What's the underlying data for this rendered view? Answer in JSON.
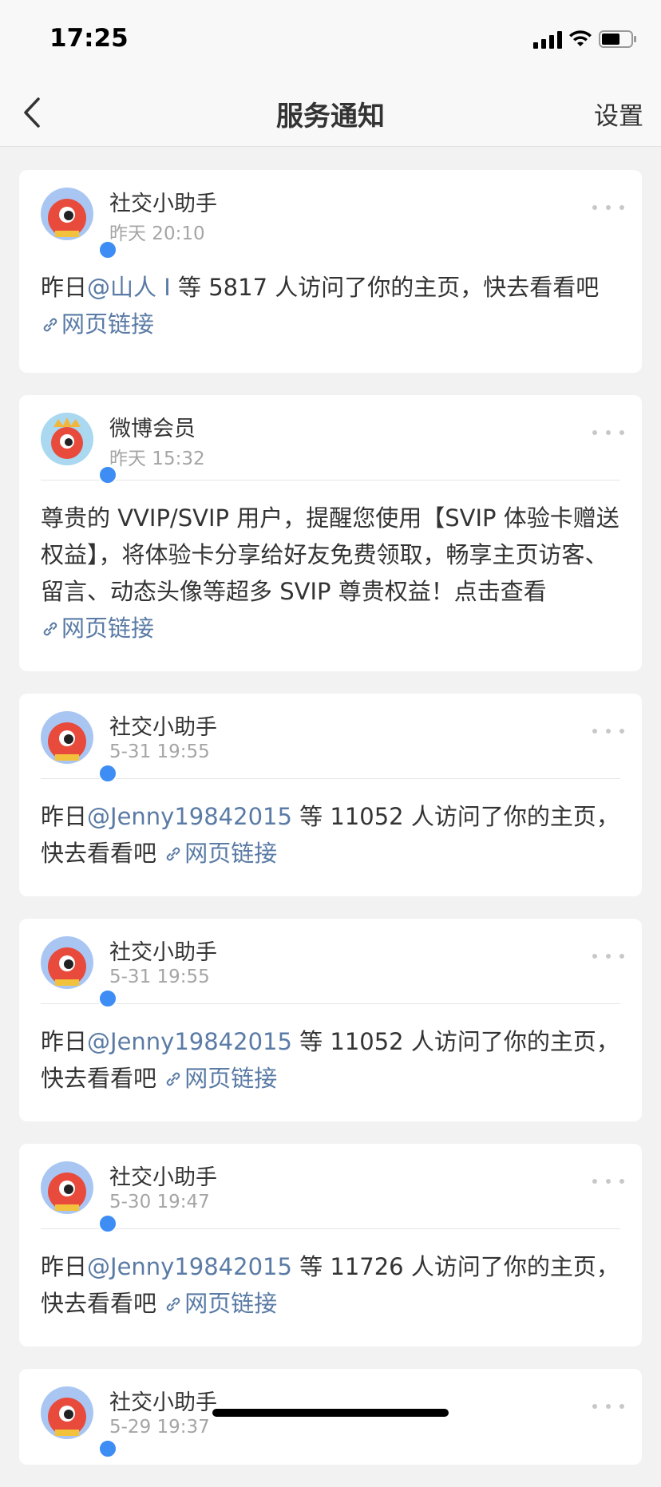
{
  "status_bar": {
    "time": "17:25"
  },
  "nav": {
    "title": "服务通知",
    "settings": "设置"
  },
  "messages": [
    {
      "sender": "社交小助手",
      "time": "昨天 20:10",
      "prefix": "昨日",
      "mention": "@山人 I",
      "text": " 等 5817 人访问了你的主页，快去看看吧",
      "link": "网页链接",
      "avatar": "social-assistant-avatar"
    },
    {
      "sender": "微博会员",
      "time": "昨天 15:32",
      "prefix": "",
      "mention": "",
      "text": "尊贵的 VVIP/SVIP 用户，提醒您使用【SVIP 体验卡赠送权益】，将体验卡分享给好友免费领取，畅享主页访客、留言、动态头像等超多 SVIP 尊贵权益！点击查看",
      "link": "网页链接",
      "avatar": "weibo-vip-avatar"
    },
    {
      "sender": "社交小助手",
      "time": "5-31 19:55",
      "prefix": "昨日",
      "mention": "@Jenny19842015",
      "text": " 等 11052 人访问了你的主页，快去看看吧",
      "link": "网页链接",
      "avatar": "social-assistant-avatar"
    },
    {
      "sender": "社交小助手",
      "time": "5-31 19:55",
      "prefix": "昨日",
      "mention": "@Jenny19842015",
      "text": " 等 11052 人访问了你的主页，快去看看吧",
      "link": "网页链接",
      "avatar": "social-assistant-avatar"
    },
    {
      "sender": "社交小助手",
      "time": "5-30 19:47",
      "prefix": "昨日",
      "mention": "@Jenny19842015",
      "text": " 等 11726 人访问了你的主页，快去看看吧",
      "link": "网页链接",
      "avatar": "social-assistant-avatar"
    },
    {
      "sender": "社交小助手",
      "time": "5-29 19:37",
      "avatar": "social-assistant-avatar"
    }
  ],
  "colors": {
    "link": "#5a7ba5",
    "verified": "#3d8df5",
    "background": "#f2f2f2"
  }
}
